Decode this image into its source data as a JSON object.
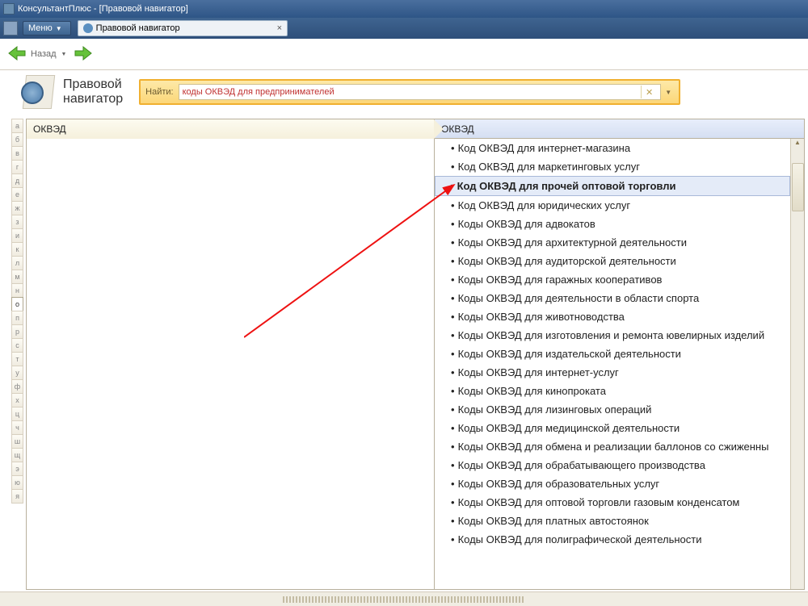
{
  "titlebar": {
    "text": "КонсультантПлюс - [Правовой навигатор]"
  },
  "menubar": {
    "menu_label": "Меню",
    "tab_label": "Правовой навигатор"
  },
  "nav": {
    "back_label": "Назад"
  },
  "page": {
    "title_line1": "Правовой",
    "title_line2": "навигатор"
  },
  "search": {
    "label": "Найти:",
    "value": "коды ОКВЭД для предпринимателей"
  },
  "alpha": [
    "а",
    "б",
    "в",
    "г",
    "д",
    "е",
    "ж",
    "з",
    "и",
    "к",
    "л",
    "м",
    "н",
    "о",
    "п",
    "р",
    "с",
    "т",
    "у",
    "ф",
    "х",
    "ц",
    "ч",
    "ш",
    "щ",
    "э",
    "ю",
    "я"
  ],
  "alpha_active": "о",
  "left": {
    "header": "ОКВЭД"
  },
  "right": {
    "header": "ОКВЭД",
    "selected_index": 2,
    "items": [
      "Код ОКВЭД для интернет-магазина",
      "Код ОКВЭД для маркетинговых услуг",
      "Код ОКВЭД для прочей оптовой торговли",
      "Код ОКВЭД для юридических услуг",
      "Коды ОКВЭД для адвокатов",
      "Коды ОКВЭД для архитектурной деятельности",
      "Коды ОКВЭД для аудиторской деятельности",
      "Коды ОКВЭД для гаражных кооперативов",
      "Коды ОКВЭД для деятельности в области спорта",
      "Коды ОКВЭД для животноводства",
      "Коды ОКВЭД для изготовления и ремонта ювелирных изделий",
      "Коды ОКВЭД для издательской деятельности",
      "Коды ОКВЭД для интернет-услуг",
      "Коды ОКВЭД для кинопроката",
      "Коды ОКВЭД для лизинговых операций",
      "Коды ОКВЭД для медицинской деятельности",
      "Коды ОКВЭД для обмена и реализации баллонов со сжиженны",
      "Коды ОКВЭД для обрабатывающего производства",
      "Коды ОКВЭД для образовательных услуг",
      "Коды ОКВЭД для оптовой торговли газовым конденсатом",
      "Коды ОКВЭД для платных автостоянок",
      "Коды ОКВЭД для полиграфической деятельности"
    ]
  }
}
